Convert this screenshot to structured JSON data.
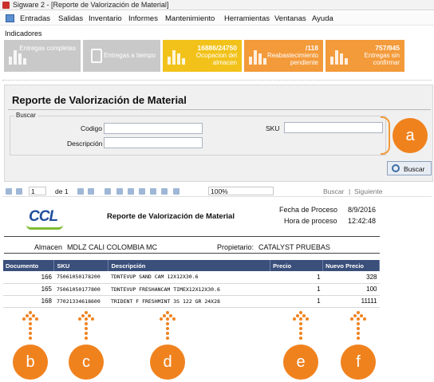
{
  "window": {
    "title": "Sigware 2 - [Reporte de Valorización de Material]",
    "app_icon": "app-icon"
  },
  "menu": {
    "items": [
      "Entradas",
      "Salidas",
      "Inventario",
      "Informes",
      "Mantenimiento",
      "Herramientas",
      "Ventanas",
      "Ayuda"
    ]
  },
  "indicators": {
    "label": "Indicadores",
    "cards": [
      {
        "value": "",
        "label": "Entregas completas",
        "color": "#c9c9c9"
      },
      {
        "value": "",
        "label": "Entregas a tiempo",
        "color": "#c9c9c9"
      },
      {
        "value": "16886/24750",
        "label": "Ocupacion del almacen",
        "color": "#f2c21a"
      },
      {
        "value": "/118",
        "label": "Reabastecimiento pendiente",
        "color": "#f39a3a"
      },
      {
        "value": "757/945",
        "label": "Entregas sin confirmar",
        "color": "#f39a3a"
      }
    ]
  },
  "panel": {
    "title": "Reporte de Valorización de Material",
    "group_label": "Buscar",
    "codigo_label": "Codigo",
    "descripcion_label": "Descripción",
    "sku_label": "SKU",
    "codigo_value": "",
    "descripcion_value": "",
    "sku_value": "",
    "buscar_button": "Buscar"
  },
  "toolbar": {
    "page_current": "1",
    "page_of": "de 1",
    "zoom": "100%",
    "find_label": "Buscar",
    "next_label": "Siguiente",
    "separator": "|"
  },
  "report": {
    "title": "Reporte de Valorización de Material",
    "logo_text": "CCL",
    "fecha_label": "Fecha de Proceso",
    "fecha_value": "8/9/2016",
    "hora_label": "Hora de proceso",
    "hora_value": "12:42:48",
    "almacen_label": "Almacen",
    "almacen_value": "MDLZ CALI COLOMBIA MC",
    "propietario_label": "Propietario:",
    "propietario_value": "CATALYST PRUEBAS",
    "columns": [
      "Documento",
      "SKU",
      "Descripción",
      "Precio",
      "Nuevo Precio"
    ],
    "rows": [
      {
        "documento": "166",
        "sku": "75061050178200",
        "descripcion": "TDNTEVUP SAND CAM 12X12X30.6",
        "precio": "1",
        "nuevo_precio": "328"
      },
      {
        "documento": "165",
        "sku": "75061050177800",
        "descripcion": "TDNTEVUP FRESHANCAM TIMEX12X12X30.6",
        "precio": "1",
        "nuevo_precio": "100"
      },
      {
        "documento": "168",
        "sku": "77021334618600",
        "descripcion": "TRIDENT F FRESHMINT 3S 122 GR 24X28",
        "precio": "1",
        "nuevo_precio": "11111"
      }
    ]
  },
  "annotations": [
    "a",
    "b",
    "c",
    "d",
    "e",
    "f"
  ],
  "accent_color": "#f0821e"
}
